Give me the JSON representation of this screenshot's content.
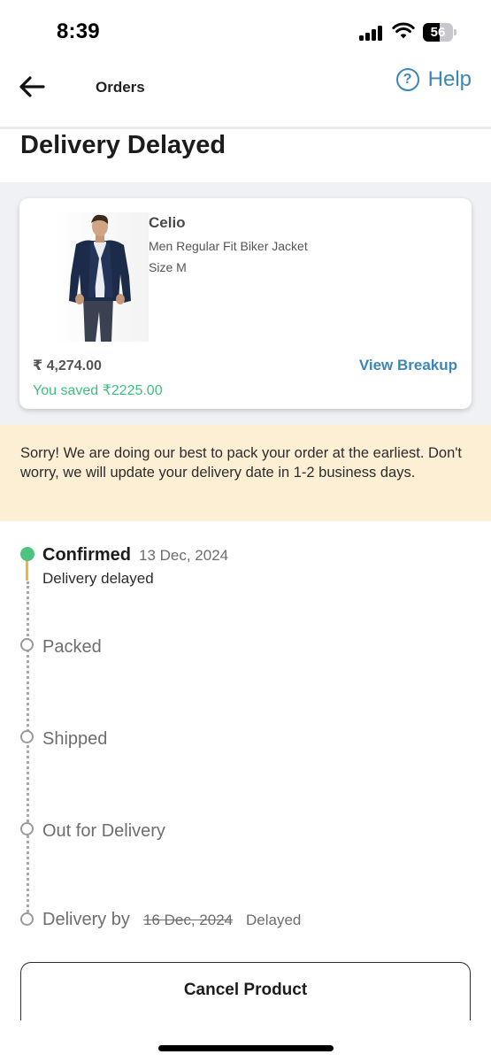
{
  "status_bar": {
    "time": "8:39",
    "battery": "56",
    "battery_level": 0.56
  },
  "header": {
    "title": "Orders",
    "help_label": "Help",
    "help_glyph": "?"
  },
  "page_title": "Delivery Delayed",
  "product": {
    "brand": "Celio",
    "name": "Men Regular Fit Biker Jacket",
    "size": "Size M",
    "price": "₹ 4,274.00",
    "saved": "You saved ₹2225.00",
    "view_breakup": "View Breakup"
  },
  "notice": "Sorry! We are doing our best to pack your order at the earliest. Don't worry, we will update your delivery date in 1-2 business days.",
  "timeline": {
    "confirmed": {
      "label": "Confirmed",
      "date": "13 Dec, 2024",
      "sub": "Delivery delayed"
    },
    "packed": "Packed",
    "shipped": "Shipped",
    "out_for_delivery": "Out for Delivery",
    "delivery_by": {
      "label": "Delivery by",
      "date": "16 Dec, 2024",
      "status": "Delayed"
    }
  },
  "cancel_button": "Cancel Product",
  "icons": {
    "back": "arrow-left-icon",
    "help": "question-circle-icon",
    "signal": "cellular-signal-icon",
    "wifi": "wifi-icon",
    "battery": "battery-icon"
  },
  "colors": {
    "accent": "#3d86b8",
    "saved": "#3fbf7f",
    "notice_bg": "#fcefd3",
    "step_done": "#4cc37f",
    "step_line_active": "#f2b43c"
  }
}
